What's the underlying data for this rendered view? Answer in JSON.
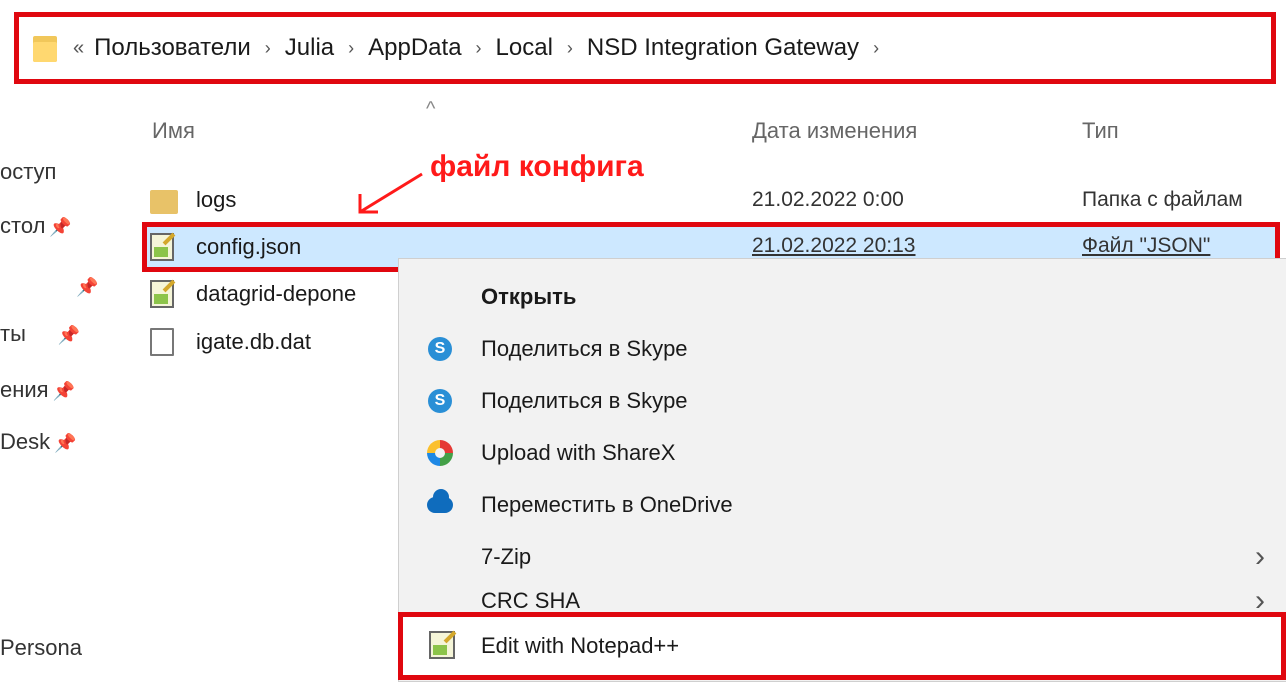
{
  "address_bar": {
    "prefix": "«",
    "crumbs": [
      "Пользователи",
      "Julia",
      "AppData",
      "Local",
      "NSD Integration Gateway"
    ],
    "separator": "›"
  },
  "sidebar": {
    "items": [
      {
        "label": "оступ",
        "pinned": false
      },
      {
        "label": "стол",
        "pinned": true
      },
      {
        "label": "",
        "pinned": true
      },
      {
        "label": "ты",
        "pinned": true
      },
      {
        "label": "ения",
        "pinned": true
      },
      {
        "label": "Desk",
        "pinned": true
      },
      {
        "label": "Persona",
        "pinned": false
      }
    ],
    "pin_glyph": "📌"
  },
  "columns": {
    "name": "Имя",
    "date": "Дата изменения",
    "type": "Тип"
  },
  "files": [
    {
      "name": "logs",
      "date": "21.02.2022 0:00",
      "type": "Папка с файлам",
      "icon": "folder-icon"
    },
    {
      "name": "config.json",
      "date": "21.02.2022 20:13",
      "type": "Файл \"JSON\"",
      "icon": "notepad-icon"
    },
    {
      "name": "datagrid-depone",
      "date": "",
      "type": "",
      "icon": "notepad-icon"
    },
    {
      "name": "igate.db.dat",
      "date": "",
      "type": "",
      "icon": "document-icon"
    }
  ],
  "annotation": {
    "text": "файл конфига",
    "color": "#ff1a1a"
  },
  "context_menu": {
    "items": [
      {
        "label": "Открыть",
        "icon": "",
        "bold": true,
        "submenu": false
      },
      {
        "label": "Поделиться в Skype",
        "icon": "skype-icon",
        "bold": false,
        "submenu": false
      },
      {
        "label": "Поделиться в Skype",
        "icon": "skype-icon",
        "bold": false,
        "submenu": false
      },
      {
        "label": "Upload with ShareX",
        "icon": "sharex-icon",
        "bold": false,
        "submenu": false
      },
      {
        "label": "Переместить в OneDrive",
        "icon": "onedrive-icon",
        "bold": false,
        "submenu": false
      },
      {
        "label": "7-Zip",
        "icon": "",
        "bold": false,
        "submenu": true
      },
      {
        "label": "CRC SHA",
        "icon": "",
        "bold": false,
        "submenu": true
      }
    ],
    "highlighted_item": {
      "label": "Edit with Notepad++",
      "icon": "notepad-plus-plus-icon"
    }
  },
  "colors": {
    "highlight_border": "#e0070f",
    "selection_bg": "#cde8ff",
    "menu_bg": "#f2f2f2"
  }
}
